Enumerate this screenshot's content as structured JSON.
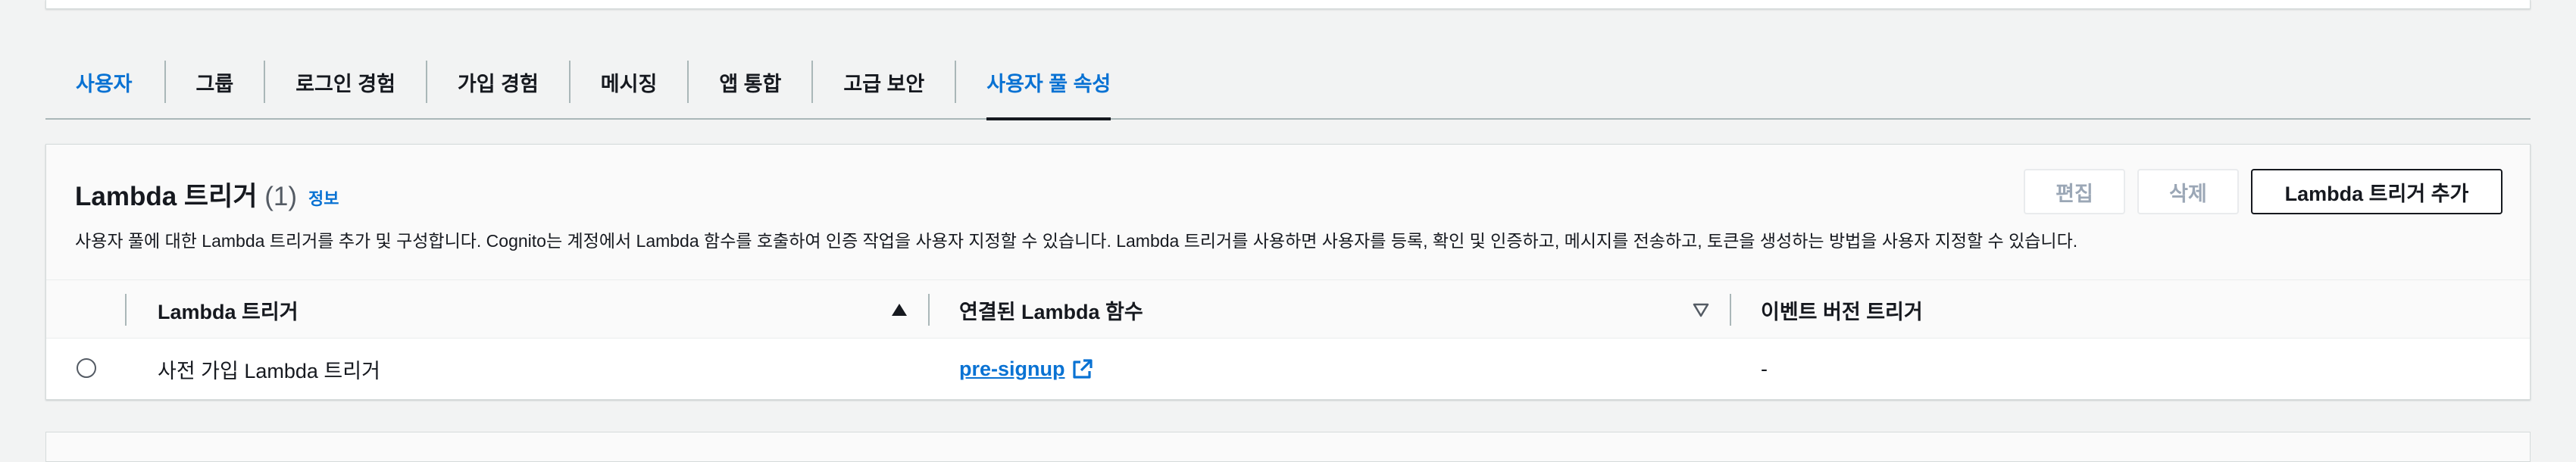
{
  "tabs": [
    {
      "label": "사용자"
    },
    {
      "label": "그룹"
    },
    {
      "label": "로그인 경험"
    },
    {
      "label": "가입 경험"
    },
    {
      "label": "메시징"
    },
    {
      "label": "앱 통합"
    },
    {
      "label": "고급 보안"
    },
    {
      "label": "사용자 풀 속성"
    }
  ],
  "panel": {
    "title": "Lambda 트리거",
    "count": "(1)",
    "info": "정보",
    "description": "사용자 풀에 대한 Lambda 트리거를 추가 및 구성합니다. Cognito는 계정에서 Lambda 함수를 호출하여 인증 작업을 사용자 지정할 수 있습니다. Lambda 트리거를 사용하면 사용자를 등록, 확인 및 인증하고, 메시지를 전송하고, 토큰을 생성하는 방법을 사용자 지정할 수 있습니다.",
    "buttons": {
      "edit": "편집",
      "delete": "삭제",
      "add": "Lambda 트리거 추가"
    }
  },
  "table": {
    "columns": [
      "Lambda 트리거",
      "연결된 Lambda 함수",
      "이벤트 버전 트리거"
    ],
    "rows": [
      {
        "trigger": "사전 가입 Lambda 트리거",
        "function": "pre-signup",
        "version": "-"
      }
    ]
  },
  "icons": {
    "sort_asc": "caret-up-filled-icon",
    "sort_desc": "caret-down-outline-icon",
    "external": "external-link-icon"
  },
  "colors": {
    "link": "#0972d3",
    "text": "#16191f",
    "background": "#f2f3f3"
  }
}
